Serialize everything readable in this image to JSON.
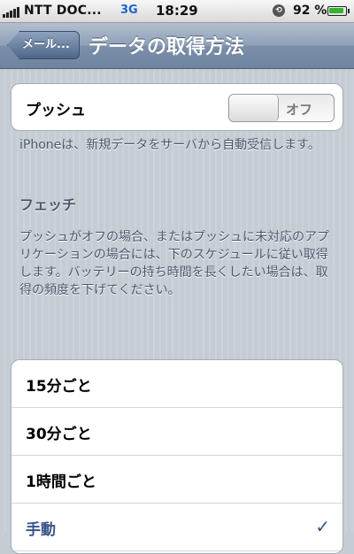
{
  "status_bar": {
    "carrier": "NTT DOC...",
    "network": "3G",
    "time": "18:29",
    "battery_percent": "92 %",
    "battery_level": 0.92,
    "icons": [
      "signal-icon",
      "orientation-lock-icon",
      "battery-icon"
    ]
  },
  "nav": {
    "back_label": "メール...",
    "title": "データの取得方法"
  },
  "push": {
    "label": "プッシュ",
    "toggle_state": "オフ",
    "description": "iPhoneは、新規データをサーバから自動受信します。"
  },
  "fetch": {
    "title": "フェッチ",
    "description": "プッシュがオフの場合、またはプッシュに未対応のアプリケーションの場合には、下のスケジュールに従い取得します。バッテリーの持ち時間を長くしたい場合は、取得の頻度を下げてください。",
    "options": [
      {
        "label": "15分ごと",
        "selected": false
      },
      {
        "label": "30分ごと",
        "selected": false
      },
      {
        "label": "1時間ごと",
        "selected": false
      },
      {
        "label": "手動",
        "selected": true
      }
    ],
    "check_glyph": "✓"
  },
  "colors": {
    "nav_bar": "#7b8fa9",
    "background": "#c5ccd4",
    "selected_text": "#385487",
    "battery_green": "#2fb52f"
  }
}
